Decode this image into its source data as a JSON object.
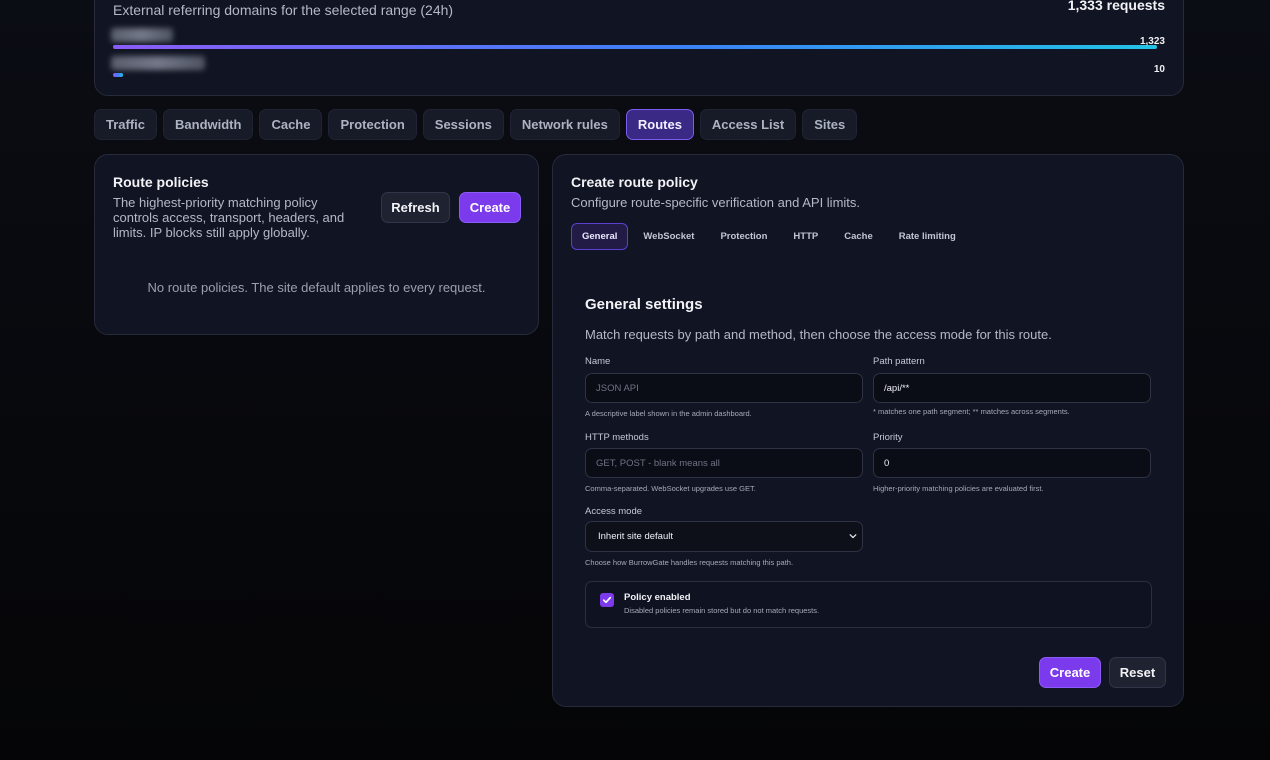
{
  "referrers": {
    "subtitle": "External referring domains for the selected range (24h)",
    "total": "1,333 requests",
    "rows": [
      {
        "value_label": "1,323",
        "share": 1.0
      },
      {
        "value_label": "10",
        "share": 0.0076
      }
    ]
  },
  "tabs": [
    {
      "label": "Traffic",
      "active": false
    },
    {
      "label": "Bandwidth",
      "active": false
    },
    {
      "label": "Cache",
      "active": false
    },
    {
      "label": "Protection",
      "active": false
    },
    {
      "label": "Sessions",
      "active": false
    },
    {
      "label": "Network rules",
      "active": false
    },
    {
      "label": "Routes",
      "active": true
    },
    {
      "label": "Access List",
      "active": false
    },
    {
      "label": "Sites",
      "active": false
    }
  ],
  "route_policies": {
    "title": "Route policies",
    "description": "The highest-priority matching policy controls access, transport, headers, and limits. IP blocks still apply globally.",
    "refresh_label": "Refresh",
    "create_label": "Create",
    "empty_text": "No route policies. The site default applies to every request."
  },
  "create_policy": {
    "title": "Create route policy",
    "subtitle": "Configure route-specific verification and API limits.",
    "subtabs": [
      {
        "label": "General",
        "active": true
      },
      {
        "label": "WebSocket",
        "active": false
      },
      {
        "label": "Protection",
        "active": false
      },
      {
        "label": "HTTP",
        "active": false
      },
      {
        "label": "Cache",
        "active": false
      },
      {
        "label": "Rate limiting",
        "active": false
      }
    ],
    "section_title": "General settings",
    "section_subtitle": "Match requests by path and method, then choose the access mode for this route.",
    "fields": {
      "name": {
        "label": "Name",
        "value": "",
        "placeholder": "JSON API",
        "help": "A descriptive label shown in the admin dashboard."
      },
      "path": {
        "label": "Path pattern",
        "value": "/api/**",
        "help": "* matches one path segment; ** matches across segments."
      },
      "methods": {
        "label": "HTTP methods",
        "value": "",
        "placeholder": "GET, POST - blank means all",
        "help": "Comma-separated. WebSocket upgrades use GET."
      },
      "priority": {
        "label": "Priority",
        "value": "0",
        "help": "Higher-priority matching policies are evaluated first."
      },
      "access_mode": {
        "label": "Access mode",
        "selected": "Inherit site default",
        "help": "Choose how BurrowGate handles requests matching this path."
      }
    },
    "enabled": {
      "title": "Policy enabled",
      "description": "Disabled policies remain stored but do not match requests.",
      "checked": true
    },
    "create_label": "Create",
    "reset_label": "Reset"
  },
  "colors": {
    "accent": "#7c3aed",
    "active_tab": "#3a2a86",
    "card": "#111422",
    "bar_start": "#8b5cf6",
    "bar_end": "#22c3e6"
  }
}
